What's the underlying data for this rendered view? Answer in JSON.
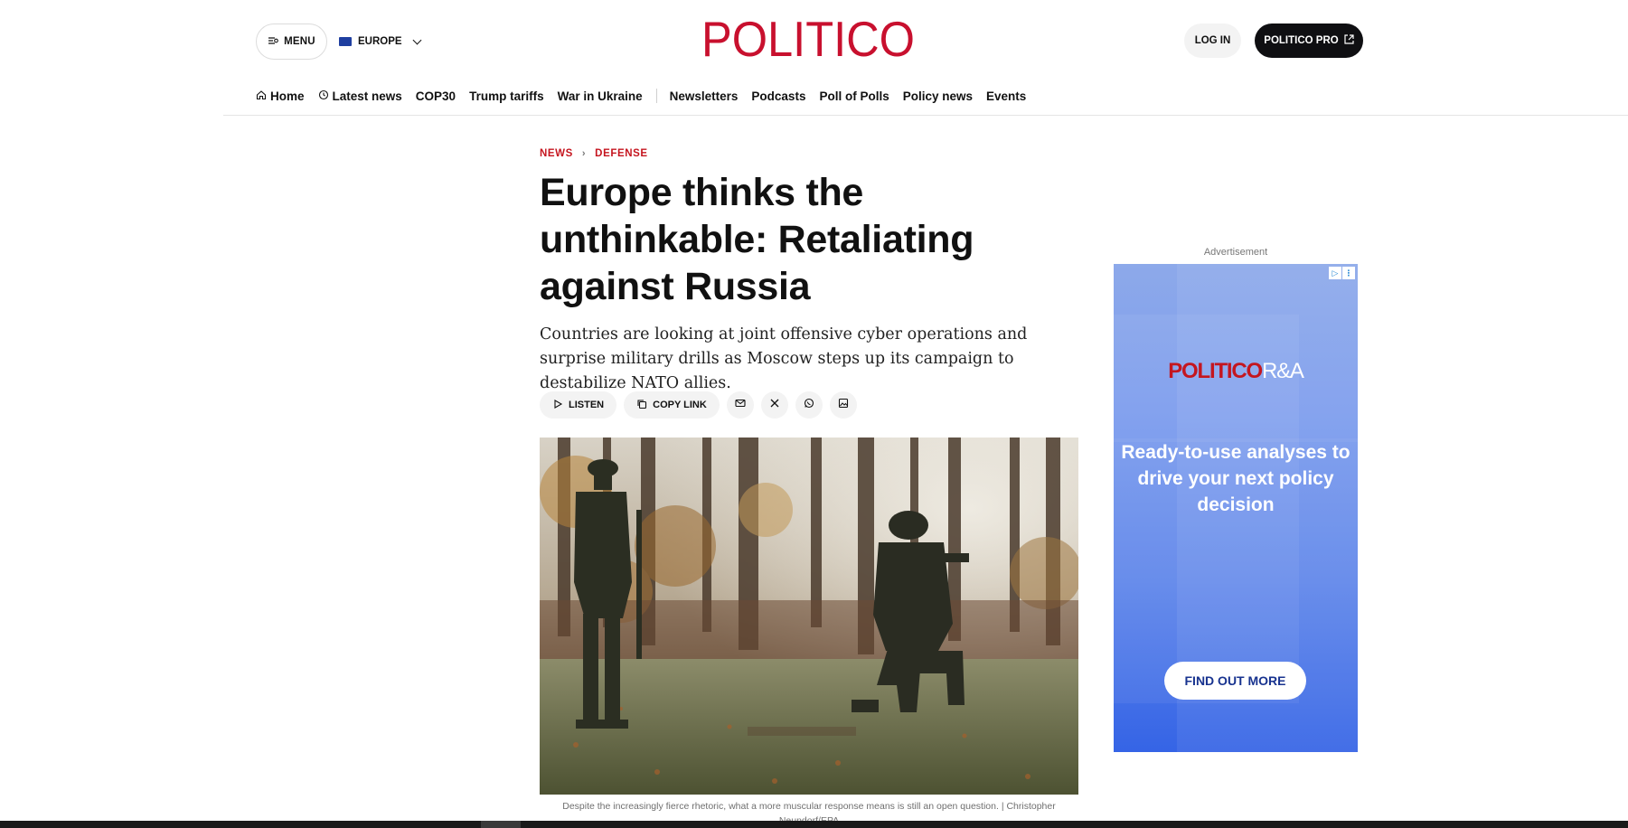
{
  "header": {
    "menu_label": "MENU",
    "region_label": "EUROPE",
    "logo_text": "POLITICO",
    "login_label": "LOG IN",
    "pro_label": "POLITICO PRO"
  },
  "nav": {
    "items": [
      {
        "label": "Home",
        "icon": "home-icon"
      },
      {
        "label": "Latest news",
        "icon": "clock-icon"
      },
      {
        "label": "COP30"
      },
      {
        "label": "Trump tariffs"
      },
      {
        "label": "War in Ukraine"
      },
      {
        "label": "Newsletters"
      },
      {
        "label": "Podcasts"
      },
      {
        "label": "Poll of Polls"
      },
      {
        "label": "Policy news"
      },
      {
        "label": "Events"
      }
    ]
  },
  "article": {
    "breadcrumb": [
      "NEWS",
      "DEFENSE"
    ],
    "headline": "Europe thinks the unthinkable: Retaliating against Russia",
    "dek": "Countries are looking at joint offensive cyber operations and surprise military drills as Moscow steps up its campaign to destabilize NATO allies.",
    "actions": {
      "listen_label": "LISTEN",
      "copy_link_label": "COPY LINK",
      "share_icons": [
        "email-icon",
        "x-icon",
        "whatsapp-icon",
        "image-icon"
      ]
    },
    "caption": "Despite the increasingly fierce rhetoric, what a more muscular response means is still an open question. | Christopher Neundorf/EPA"
  },
  "advert": {
    "label": "Advertisement",
    "brand": "POLITICO",
    "brand_suffix": "R&A",
    "copy": "Ready-to-use analyses to drive your next policy decision",
    "cta": "FIND OUT MORE"
  },
  "colors": {
    "brand_red": "#c8102e",
    "pro_button": "#0f0f12",
    "ad_blue": "#3564e6"
  }
}
